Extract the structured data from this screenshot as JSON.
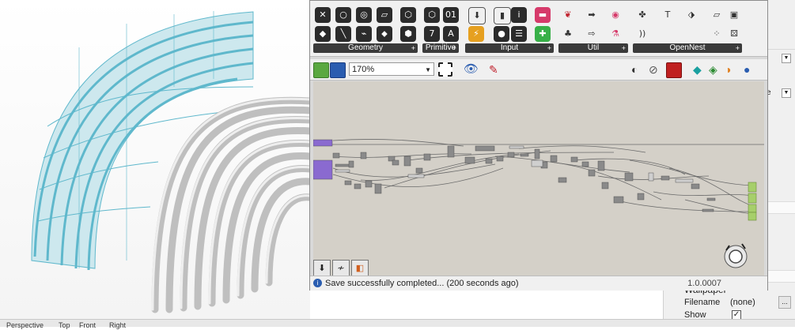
{
  "grasshopper": {
    "toolbar_groups": [
      {
        "label": "Geometry"
      },
      {
        "label": "Primitive"
      },
      {
        "label": "Input"
      },
      {
        "label": "Util"
      },
      {
        "label": "OpenNest"
      }
    ],
    "zoom": "170%",
    "status_message": "Save successfully completed... (200 seconds ago)",
    "version": "1.0.0007"
  },
  "properties_panel": {
    "section_title": "Wallpaper",
    "filename_label": "Filename",
    "filename_value": "(none)",
    "show_label": "Show",
    "dots_label": "..."
  },
  "bottom_tabs": {
    "tab1": "Perspective",
    "tab2": "Top",
    "tab3": "Front",
    "tab4": "Right"
  },
  "colors": {
    "accent_cyan": "#5fb8cc",
    "canvas_bg": "#d4d0c8",
    "component_gray": "#8a8a8a",
    "input_purple": "#8a6ad0",
    "output_green": "#a6cf6a"
  }
}
